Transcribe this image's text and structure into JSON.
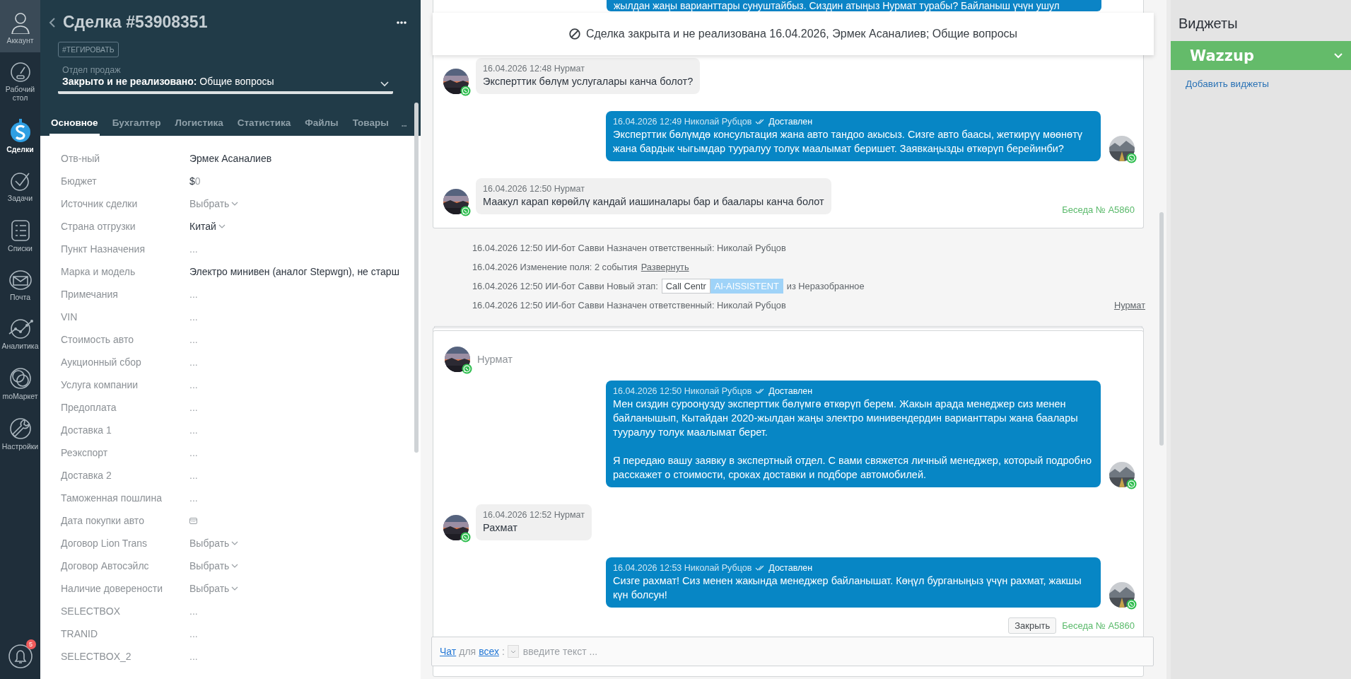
{
  "nav": {
    "items": [
      {
        "label": "Аккаунт",
        "kind": "avatar",
        "selected": false
      },
      {
        "label": "Рабочий стол",
        "kind": "gauge",
        "selected": false
      },
      {
        "label": "Сделки",
        "kind": "deals",
        "selected": true
      },
      {
        "label": "Задачи",
        "kind": "tasks",
        "selected": false
      },
      {
        "label": "Списки",
        "kind": "lists",
        "selected": false
      },
      {
        "label": "Почта",
        "kind": "mail",
        "selected": false
      },
      {
        "label": "Аналитика",
        "kind": "analytics",
        "selected": false
      },
      {
        "label": "moМаркет",
        "kind": "market",
        "selected": false
      },
      {
        "label": "Настройки",
        "kind": "settings",
        "selected": false
      }
    ],
    "notifications": {
      "badge": "5"
    }
  },
  "deal": {
    "title": "Сделка #53908351",
    "tag_button": "#ТЕГИРОВАТЬ",
    "pipeline": "Отдел продаж",
    "status": "**Закрыто и не реализовано:** Общие вопросы",
    "tabs": [
      {
        "label": "Основное",
        "selected": true
      },
      {
        "label": "Бухгалтер",
        "selected": false
      },
      {
        "label": "Логистика",
        "selected": false
      },
      {
        "label": "Статистика",
        "selected": false
      },
      {
        "label": "Файлы",
        "selected": false
      },
      {
        "label": "Товары",
        "selected": false
      }
    ],
    "fields": [
      {
        "label": "Отв-ный",
        "kind": "text",
        "value": "Эрмек Асаналиев"
      },
      {
        "label": "Бюджет",
        "kind": "money",
        "currency": "$",
        "value": "0"
      },
      {
        "label": "Источник сделки",
        "kind": "select",
        "placeholder": "Выбрать"
      },
      {
        "label": "Страна отгрузки",
        "kind": "select",
        "value": "Китай"
      },
      {
        "label": "Пункт Назначения",
        "kind": "empty",
        "placeholder": "..."
      },
      {
        "label": "Марка и модель",
        "kind": "text",
        "value": "Электро минивен (аналог Stepwgn), не старш"
      },
      {
        "label": "Примечания",
        "kind": "empty",
        "placeholder": "..."
      },
      {
        "label": "VIN",
        "kind": "empty",
        "placeholder": "..."
      },
      {
        "label": "Стоимость авто",
        "kind": "empty",
        "placeholder": "..."
      },
      {
        "label": "Аукционный сбор",
        "kind": "empty",
        "placeholder": "..."
      },
      {
        "label": "Услуга компании",
        "kind": "empty",
        "placeholder": "..."
      },
      {
        "label": "Предоплата",
        "kind": "empty",
        "placeholder": "..."
      },
      {
        "label": "Доставка 1",
        "kind": "empty",
        "placeholder": "..."
      },
      {
        "label": "Реэкспорт",
        "kind": "empty",
        "placeholder": "..."
      },
      {
        "label": "Доставка 2",
        "kind": "empty",
        "placeholder": "..."
      },
      {
        "label": "Таможенная пошлина",
        "kind": "empty",
        "placeholder": "..."
      },
      {
        "label": "Дата покупки авто",
        "kind": "date"
      },
      {
        "label": "Договор Lion Trans",
        "kind": "select",
        "placeholder": "Выбрать"
      },
      {
        "label": "Договор Автосэйлс",
        "kind": "select",
        "placeholder": "Выбрать"
      },
      {
        "label": "Наличие доверености",
        "kind": "select",
        "placeholder": "Выбрать"
      },
      {
        "label": "SELECTBOX",
        "kind": "empty",
        "placeholder": "..."
      },
      {
        "label": "TRANID",
        "kind": "empty",
        "placeholder": "..."
      },
      {
        "label": "SELECTBOX_2",
        "kind": "empty",
        "placeholder": "..."
      }
    ]
  },
  "chat": {
    "banner": "Сделка закрыта и не реализована 16.04.2026, Эрмек Асаналиев; Общие вопросы",
    "cards": [
      {
        "cut_message": "жылдан жаңы варианттары сунуштайбыз. Сиздин атыңыз Нурмат турабы? Байланыш үчүн ушул",
        "messages": [
          {
            "kind": "incoming",
            "meta": "16.04.2026 12:48 Нурмат",
            "text": "Эксперттик бөлүм услугалары канча болот?"
          },
          {
            "kind": "outgoing",
            "meta": "16.04.2026 12:49 Николай Рубцов",
            "status": "Доставлен",
            "text": "Эксперттик бөлүмдө консультация жана авто тандоо акысыз. Сизге авто баасы, жеткирүү мөөнөтү жана бардык чыгымдар тууралуу толук маалымат беришет. Заявкаңызды өткөрүп берейинби?"
          },
          {
            "kind": "incoming",
            "meta": "16.04.2026 12:50 Нурмат",
            "text": "Маакул карап көрөйлү кандай иашиналары бар и баалары канча болот"
          }
        ],
        "conversation": "Беседа № A5860"
      }
    ],
    "events": [
      {
        "kind": "assign",
        "text": "16.04.2026 12:50 ИИ-бот Савви Назначен ответственный: Николай Рубцов"
      },
      {
        "kind": "field_change",
        "text": "16.04.2026 Изменение поля: 2 события",
        "link": "Развернуть"
      },
      {
        "kind": "stage",
        "text": "16.04.2026 12:50 ИИ-бот Савви Новый этап:",
        "old_stage": "Call Centr",
        "new_stage": "AI-AISSISTENT",
        "suffix": "из Неразобранное"
      },
      {
        "kind": "assign",
        "text": "16.04.2026 12:50 ИИ-бот Савви Назначен ответственный: Николай Рубцов",
        "contact_link": "Нурмат"
      }
    ],
    "thread": {
      "contact": "Нурмат",
      "messages": [
        {
          "kind": "outgoing",
          "meta": "16.04.2026 12:50 Николай Рубцов",
          "status": "Доставлен",
          "text": "Мен сиздин сурооңузду эксперттик бөлүмгө өткөрүп берем. Жакын арада менеджер сиз менен байланышып, Кытайдан 2020-жылдан жаңы электро минивендердин варианттары жана баалары тууралуу толук маалымат берет.\n\nЯ передаю вашу заявку в экспертный отдел. С вами свяжется личный менеджер, который подробно расскажет о стоимости, сроках доставки и подборе автомобилей."
        },
        {
          "kind": "incoming",
          "meta": "16.04.2026 12:52 Нурмат",
          "text": "Рахмат"
        },
        {
          "kind": "outgoing",
          "meta": "16.04.2026 12:53 Николай Рубцов",
          "status": "Доставлен",
          "text": "Сизге рахмат! Сиз менен жакында менеджер байланышат. Көңүл бурганыңыз үчүн рахмат, жакшы күн болсун!"
        }
      ],
      "close_button": "Закрыть",
      "conversation": "Беседа № A5860"
    },
    "composer": {
      "mode_link": "Чат",
      "for_word": "для",
      "target_link": "всех",
      "colon": ":",
      "placeholder": "введите текст ..."
    }
  },
  "widgets": {
    "title": "Виджеты",
    "items": [
      {
        "name": "Wazzup",
        "expanded": false
      }
    ],
    "add_link": "Добавить виджеты"
  }
}
